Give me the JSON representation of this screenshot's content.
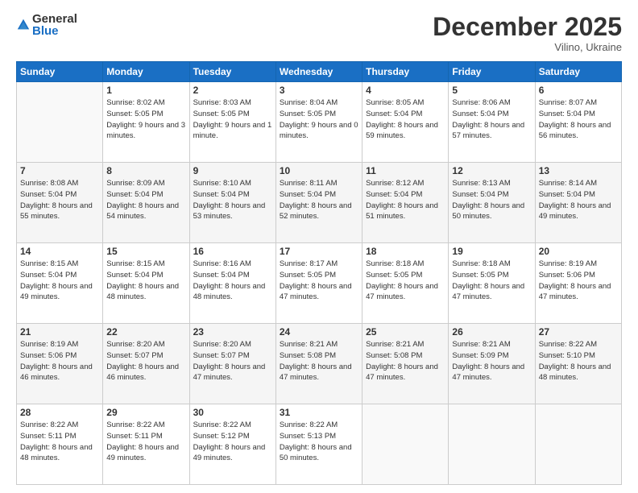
{
  "logo": {
    "general": "General",
    "blue": "Blue"
  },
  "header": {
    "month": "December 2025",
    "location": "Vilino, Ukraine"
  },
  "days_of_week": [
    "Sunday",
    "Monday",
    "Tuesday",
    "Wednesday",
    "Thursday",
    "Friday",
    "Saturday"
  ],
  "weeks": [
    [
      {
        "day": "",
        "sunrise": "",
        "sunset": "",
        "daylight": ""
      },
      {
        "day": "1",
        "sunrise": "Sunrise: 8:02 AM",
        "sunset": "Sunset: 5:05 PM",
        "daylight": "Daylight: 9 hours and 3 minutes."
      },
      {
        "day": "2",
        "sunrise": "Sunrise: 8:03 AM",
        "sunset": "Sunset: 5:05 PM",
        "daylight": "Daylight: 9 hours and 1 minute."
      },
      {
        "day": "3",
        "sunrise": "Sunrise: 8:04 AM",
        "sunset": "Sunset: 5:05 PM",
        "daylight": "Daylight: 9 hours and 0 minutes."
      },
      {
        "day": "4",
        "sunrise": "Sunrise: 8:05 AM",
        "sunset": "Sunset: 5:04 PM",
        "daylight": "Daylight: 8 hours and 59 minutes."
      },
      {
        "day": "5",
        "sunrise": "Sunrise: 8:06 AM",
        "sunset": "Sunset: 5:04 PM",
        "daylight": "Daylight: 8 hours and 57 minutes."
      },
      {
        "day": "6",
        "sunrise": "Sunrise: 8:07 AM",
        "sunset": "Sunset: 5:04 PM",
        "daylight": "Daylight: 8 hours and 56 minutes."
      }
    ],
    [
      {
        "day": "7",
        "sunrise": "Sunrise: 8:08 AM",
        "sunset": "Sunset: 5:04 PM",
        "daylight": "Daylight: 8 hours and 55 minutes."
      },
      {
        "day": "8",
        "sunrise": "Sunrise: 8:09 AM",
        "sunset": "Sunset: 5:04 PM",
        "daylight": "Daylight: 8 hours and 54 minutes."
      },
      {
        "day": "9",
        "sunrise": "Sunrise: 8:10 AM",
        "sunset": "Sunset: 5:04 PM",
        "daylight": "Daylight: 8 hours and 53 minutes."
      },
      {
        "day": "10",
        "sunrise": "Sunrise: 8:11 AM",
        "sunset": "Sunset: 5:04 PM",
        "daylight": "Daylight: 8 hours and 52 minutes."
      },
      {
        "day": "11",
        "sunrise": "Sunrise: 8:12 AM",
        "sunset": "Sunset: 5:04 PM",
        "daylight": "Daylight: 8 hours and 51 minutes."
      },
      {
        "day": "12",
        "sunrise": "Sunrise: 8:13 AM",
        "sunset": "Sunset: 5:04 PM",
        "daylight": "Daylight: 8 hours and 50 minutes."
      },
      {
        "day": "13",
        "sunrise": "Sunrise: 8:14 AM",
        "sunset": "Sunset: 5:04 PM",
        "daylight": "Daylight: 8 hours and 49 minutes."
      }
    ],
    [
      {
        "day": "14",
        "sunrise": "Sunrise: 8:15 AM",
        "sunset": "Sunset: 5:04 PM",
        "daylight": "Daylight: 8 hours and 49 minutes."
      },
      {
        "day": "15",
        "sunrise": "Sunrise: 8:15 AM",
        "sunset": "Sunset: 5:04 PM",
        "daylight": "Daylight: 8 hours and 48 minutes."
      },
      {
        "day": "16",
        "sunrise": "Sunrise: 8:16 AM",
        "sunset": "Sunset: 5:04 PM",
        "daylight": "Daylight: 8 hours and 48 minutes."
      },
      {
        "day": "17",
        "sunrise": "Sunrise: 8:17 AM",
        "sunset": "Sunset: 5:05 PM",
        "daylight": "Daylight: 8 hours and 47 minutes."
      },
      {
        "day": "18",
        "sunrise": "Sunrise: 8:18 AM",
        "sunset": "Sunset: 5:05 PM",
        "daylight": "Daylight: 8 hours and 47 minutes."
      },
      {
        "day": "19",
        "sunrise": "Sunrise: 8:18 AM",
        "sunset": "Sunset: 5:05 PM",
        "daylight": "Daylight: 8 hours and 47 minutes."
      },
      {
        "day": "20",
        "sunrise": "Sunrise: 8:19 AM",
        "sunset": "Sunset: 5:06 PM",
        "daylight": "Daylight: 8 hours and 47 minutes."
      }
    ],
    [
      {
        "day": "21",
        "sunrise": "Sunrise: 8:19 AM",
        "sunset": "Sunset: 5:06 PM",
        "daylight": "Daylight: 8 hours and 46 minutes."
      },
      {
        "day": "22",
        "sunrise": "Sunrise: 8:20 AM",
        "sunset": "Sunset: 5:07 PM",
        "daylight": "Daylight: 8 hours and 46 minutes."
      },
      {
        "day": "23",
        "sunrise": "Sunrise: 8:20 AM",
        "sunset": "Sunset: 5:07 PM",
        "daylight": "Daylight: 8 hours and 47 minutes."
      },
      {
        "day": "24",
        "sunrise": "Sunrise: 8:21 AM",
        "sunset": "Sunset: 5:08 PM",
        "daylight": "Daylight: 8 hours and 47 minutes."
      },
      {
        "day": "25",
        "sunrise": "Sunrise: 8:21 AM",
        "sunset": "Sunset: 5:08 PM",
        "daylight": "Daylight: 8 hours and 47 minutes."
      },
      {
        "day": "26",
        "sunrise": "Sunrise: 8:21 AM",
        "sunset": "Sunset: 5:09 PM",
        "daylight": "Daylight: 8 hours and 47 minutes."
      },
      {
        "day": "27",
        "sunrise": "Sunrise: 8:22 AM",
        "sunset": "Sunset: 5:10 PM",
        "daylight": "Daylight: 8 hours and 48 minutes."
      }
    ],
    [
      {
        "day": "28",
        "sunrise": "Sunrise: 8:22 AM",
        "sunset": "Sunset: 5:11 PM",
        "daylight": "Daylight: 8 hours and 48 minutes."
      },
      {
        "day": "29",
        "sunrise": "Sunrise: 8:22 AM",
        "sunset": "Sunset: 5:11 PM",
        "daylight": "Daylight: 8 hours and 49 minutes."
      },
      {
        "day": "30",
        "sunrise": "Sunrise: 8:22 AM",
        "sunset": "Sunset: 5:12 PM",
        "daylight": "Daylight: 8 hours and 49 minutes."
      },
      {
        "day": "31",
        "sunrise": "Sunrise: 8:22 AM",
        "sunset": "Sunset: 5:13 PM",
        "daylight": "Daylight: 8 hours and 50 minutes."
      },
      {
        "day": "",
        "sunrise": "",
        "sunset": "",
        "daylight": ""
      },
      {
        "day": "",
        "sunrise": "",
        "sunset": "",
        "daylight": ""
      },
      {
        "day": "",
        "sunrise": "",
        "sunset": "",
        "daylight": ""
      }
    ]
  ]
}
